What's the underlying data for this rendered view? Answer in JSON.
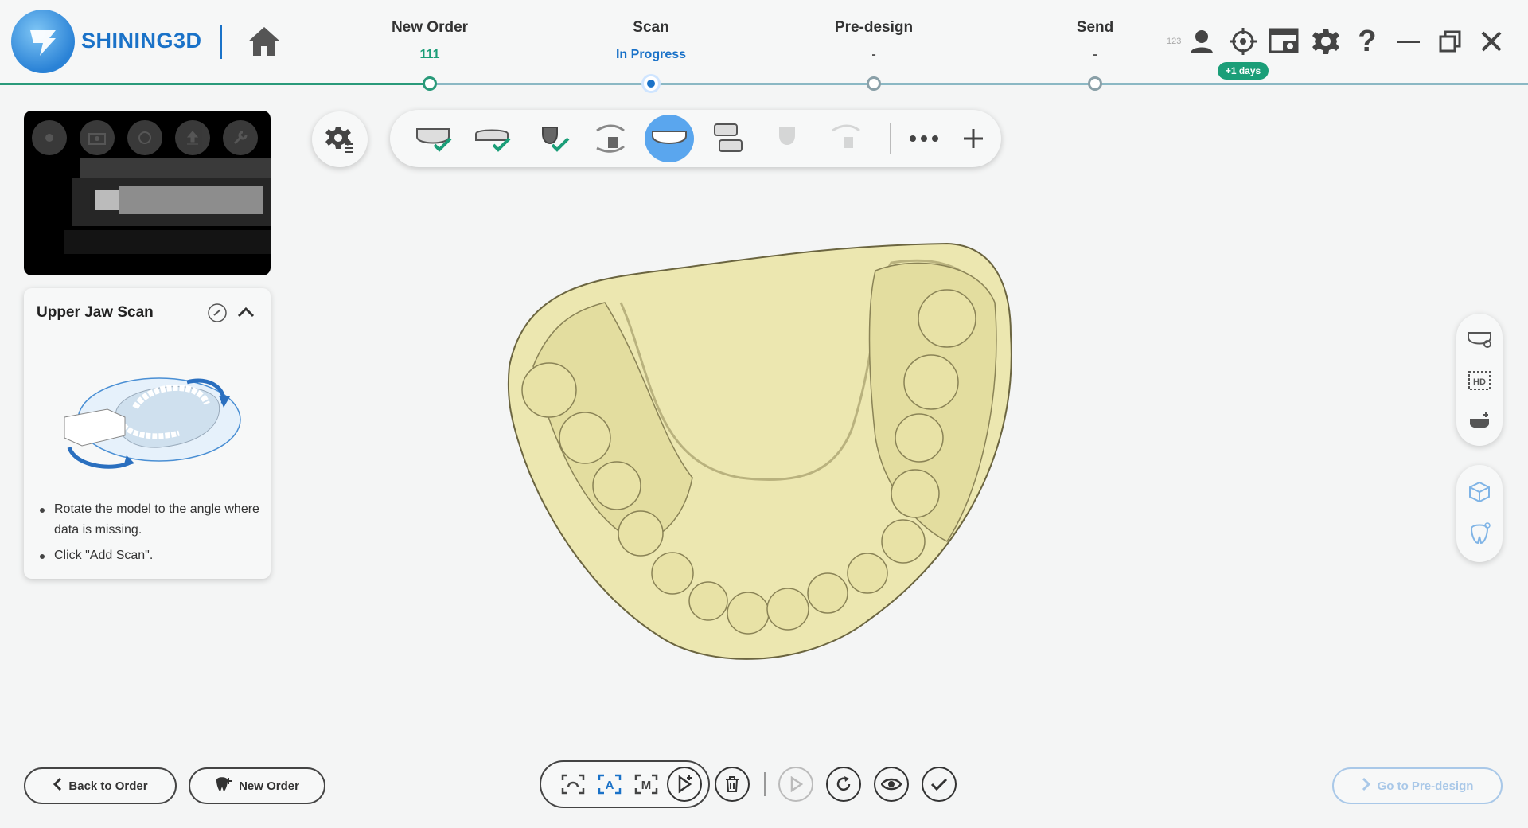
{
  "brand": {
    "name": "SHINING3D"
  },
  "steps": [
    {
      "title": "New Order",
      "sub": "111",
      "state": "done",
      "color": "#1b9e78"
    },
    {
      "title": "Scan",
      "sub": "In Progress",
      "state": "current",
      "color": "#1a72c8"
    },
    {
      "title": "Pre-design",
      "sub": "-",
      "state": "pending",
      "color": "#555"
    },
    {
      "title": "Send",
      "sub": "-",
      "state": "pending",
      "color": "#555"
    }
  ],
  "header_icons": [
    "user-icon",
    "target-icon",
    "screenshot-icon",
    "gear-icon",
    "help-icon",
    "minimize-icon",
    "restore-icon",
    "close-icon"
  ],
  "counter": "123",
  "days_badge": "+1 days",
  "panel": {
    "title": "Upper Jaw Scan",
    "instructions": [
      "Rotate the model to the angle where data is missing.",
      "Click \"Add Scan\"."
    ]
  },
  "bottom": {
    "back_label": "Back to Order",
    "new_order_label": "New Order",
    "go_label": "Go to Pre-design"
  },
  "colors": {
    "accent": "#1a72c8",
    "done": "#1b9e78",
    "model": "#ece7b0"
  }
}
